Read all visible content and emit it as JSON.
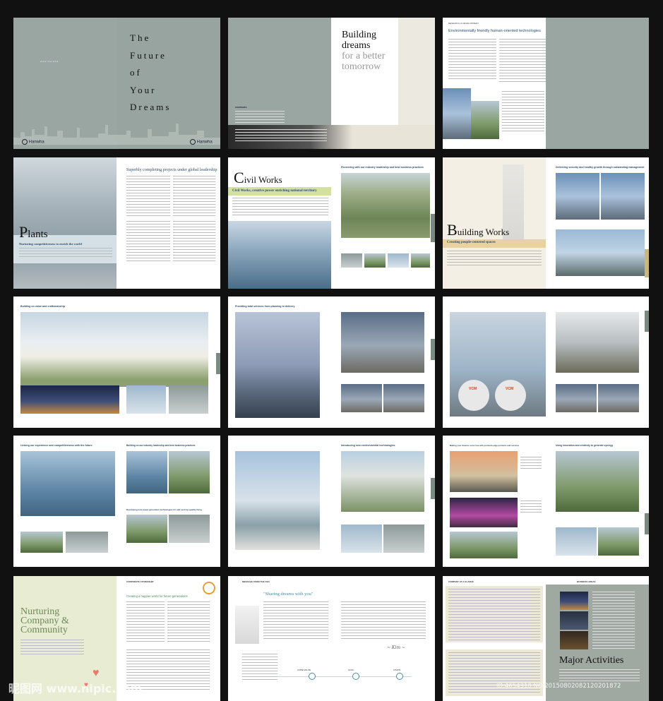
{
  "cover": {
    "title_lines": [
      "The",
      "Future",
      "of",
      "Your",
      "Dreams"
    ],
    "logo_text": "Hanwha",
    "contents_label": "CONTENTS"
  },
  "spread2": {
    "headline_1": "Building",
    "headline_2": "dreams",
    "headline_3": "for a better",
    "headline_4": "tomorrow"
  },
  "spread3": {
    "heading": "Environmentally friendly human-oriented technologies"
  },
  "plants": {
    "heading": "Superbly completing projects under global leadership",
    "title_cap": "P",
    "title_rest": "lants",
    "tagline": "Nurturing competitiveness to enrich the world"
  },
  "civil": {
    "title_cap": "C",
    "title_rest": "ivil Works",
    "subtitle": "Civil Works, creative power enriching national territory",
    "right_heading": "Pioneering with our industry leadership and best business practices"
  },
  "building": {
    "title_cap": "B",
    "title_rest": "uilding Works",
    "tagline": "Creating people-centered spaces",
    "right_heading": "Delivering security and healthy growth through outstanding management"
  },
  "row3": {
    "spread1_heading": "Building on value and craftsmanship",
    "spread2_heading": "Providing total services from planning to delivery",
    "vcm_label": "VCM"
  },
  "row4": {
    "left_heading_a": "Linking our experience and competitiveness with the future",
    "left_heading_b": "Building on our industry leadership and best business practices",
    "left_heading_c": "Developing new power generation technologies for safe and top-quality living",
    "mid_heading": "Introducing new environmental technologies",
    "right_heading_a": "Making your dreams come true with premium-edge products and services",
    "right_heading_b": "Using innovation and creativity to generate synergy"
  },
  "nurturing": {
    "title_1": "Nurturing",
    "title_2": "Company &",
    "title_3": "Community",
    "right_label": "CORPORATE CITIZENSHIP",
    "right_heading": "Creating a happier world for future generations"
  },
  "sharing": {
    "top_label": "MESSAGE FROM THE CEO",
    "quote": "\"Sharing dreams with you\"",
    "core_value": "CORE VALUE",
    "goal": "GOAL",
    "vision": "VISION"
  },
  "activities": {
    "left_label": "COMPANY AT A GLANCE",
    "right_label": "BUSINESS AREAS",
    "title": "Major Activities"
  },
  "watermark": {
    "left": "昵图网 www.nipic.com",
    "right": "ID:4654310 NO:20150802082120201872"
  }
}
